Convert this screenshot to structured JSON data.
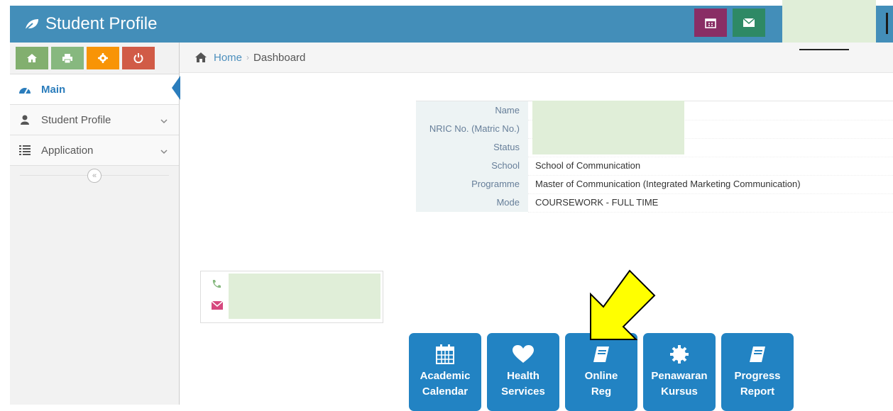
{
  "header": {
    "title": "Student Profile",
    "accent": "#438eb9"
  },
  "shortcuts": [
    {
      "icon": "home-icon"
    },
    {
      "icon": "print-icon"
    },
    {
      "icon": "gear-icon"
    },
    {
      "icon": "power-icon"
    }
  ],
  "sidebar": {
    "items": [
      {
        "label": "Main",
        "icon": "dashboard-icon",
        "active": true
      },
      {
        "label": "Student Profile",
        "icon": "user-icon"
      },
      {
        "label": "Application",
        "icon": "list-icon"
      }
    ],
    "collapse_label": "«"
  },
  "breadcrumb": {
    "home": "Home",
    "current": "Dashboard"
  },
  "profile": {
    "rows": [
      {
        "label": "Name",
        "value": ""
      },
      {
        "label": "NRIC No. (Matric No.)",
        "value": ""
      },
      {
        "label": "Status",
        "value": ""
      },
      {
        "label": "School",
        "value": "School of Communication"
      },
      {
        "label": "Programme",
        "value": "Master of Communication (Integrated Marketing Communication)"
      },
      {
        "label": "Mode",
        "value": "COURSEWORK - FULL TIME"
      }
    ]
  },
  "tiles": [
    {
      "line1": "Academic",
      "line2": "Calendar",
      "icon": "calendar-icon"
    },
    {
      "line1": "Health",
      "line2": "Services",
      "icon": "heart-icon"
    },
    {
      "line1": "Online",
      "line2": "Reg",
      "icon": "book-icon"
    },
    {
      "line1": "Penawaran",
      "line2": "Kursus",
      "icon": "cog-icon"
    },
    {
      "line1": "Progress",
      "line2": "Report",
      "icon": "book-icon"
    }
  ]
}
